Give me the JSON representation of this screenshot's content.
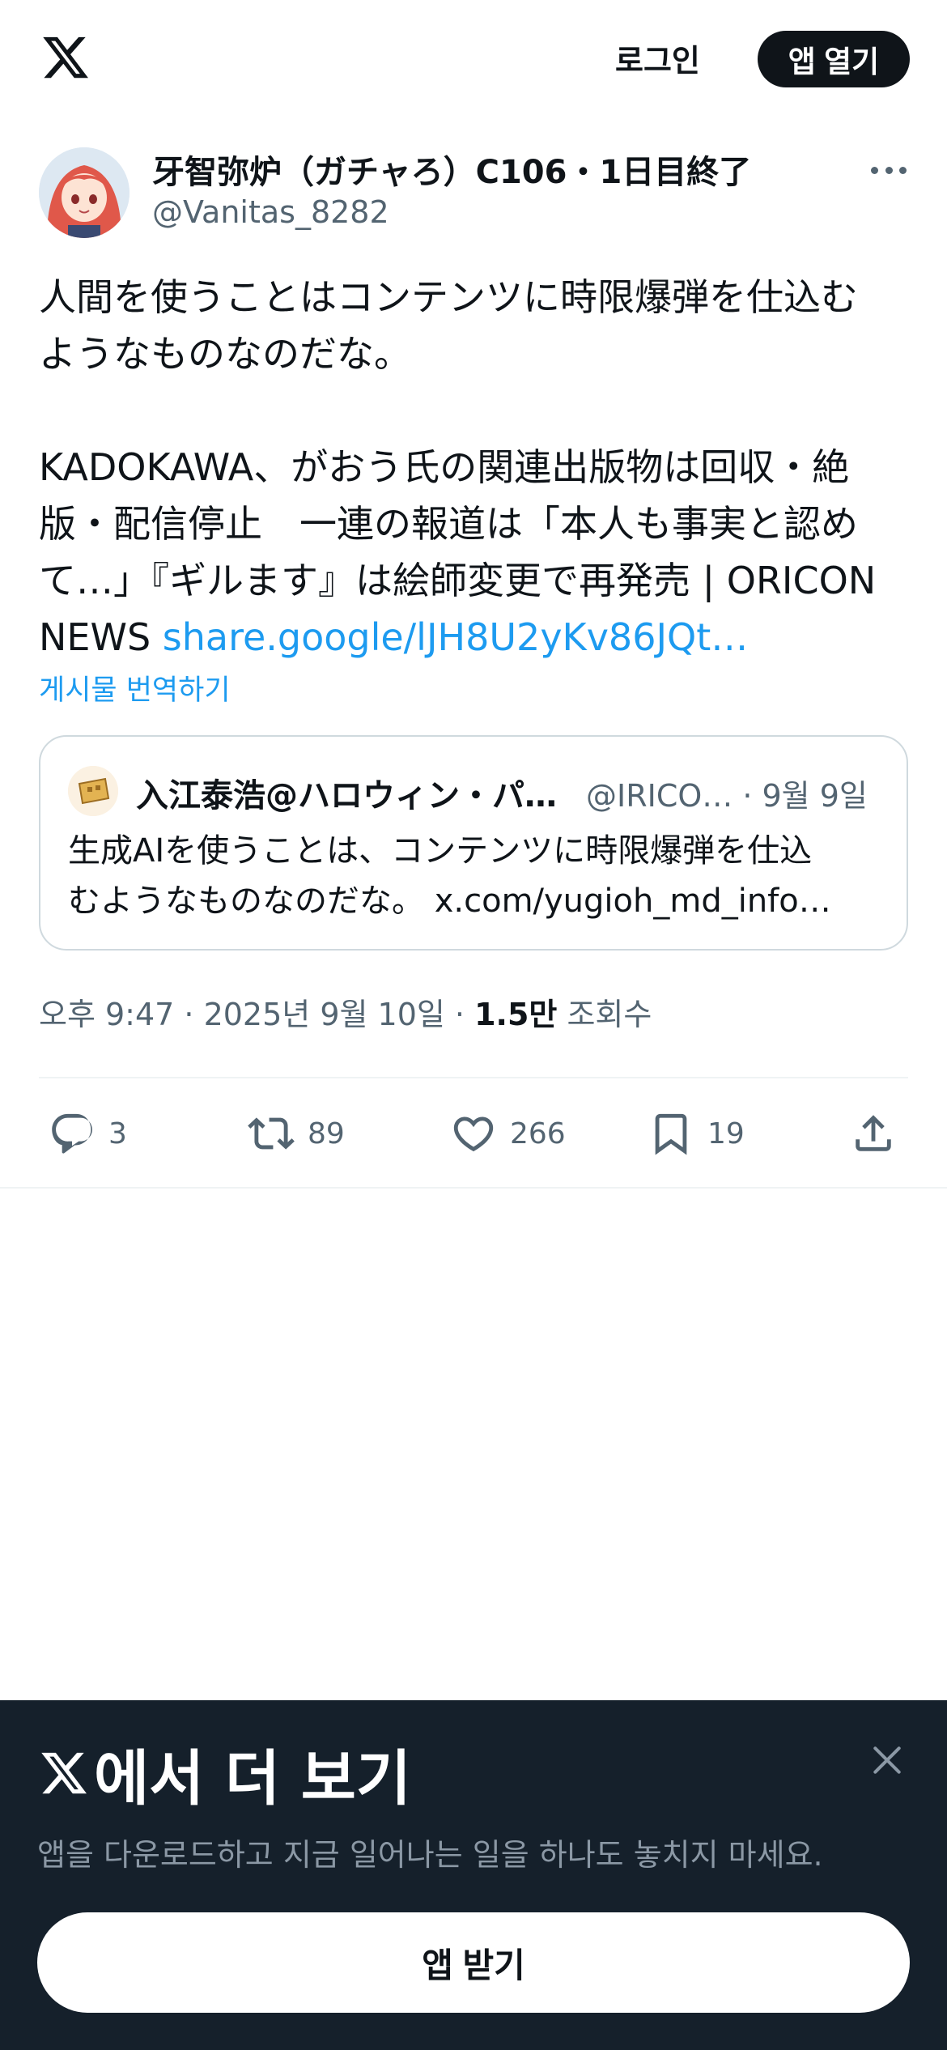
{
  "header": {
    "logo": "x-logo",
    "login_label": "로그인",
    "open_app_label": "앱 열기"
  },
  "tweet": {
    "author": {
      "name": "牙智弥炉（ガチャろ）C106・1日目終了",
      "handle": "@Vanitas_8282"
    },
    "text_lines": [
      "人間を使うことはコンテンツに時限爆弾を仕込む",
      "ようなものなのだな。",
      "",
      "KADOKAWA、がおう氏の関連出版物は回収・絶",
      "版・配信停止　一連の報道は「本人も事実と認め",
      "て…」『ギルます』は絵師変更で再発売 | ORICON"
    ],
    "last_line_prefix": "NEWS ",
    "link": "share.google/lJH8U2yKv86JQt…",
    "translate_label": "게시물 번역하기",
    "quote": {
      "name": "入江泰浩@ハロウィン・パ…",
      "handle_date": "@IRICO… · 9월 9일",
      "text_lines": [
        "生成AIを使うことは、コンテンツに時限爆弾を仕込",
        "むようなものなのだな。 x.com/yugioh_md_info…"
      ]
    },
    "timestamp": "오후 9:47 · 2025년 9월 10일 · ",
    "views_count": "1.5만",
    "views_label": " 조회수",
    "actions": {
      "reply": {
        "icon": "reply-icon",
        "count": "3"
      },
      "retweet": {
        "icon": "retweet-icon",
        "count": "89"
      },
      "like": {
        "icon": "heart-icon",
        "count": "266"
      },
      "bookmark": {
        "icon": "bookmark-icon",
        "count": "19"
      },
      "share": {
        "icon": "share-icon"
      }
    }
  },
  "bottom_sheet": {
    "title_suffix": "에서 더 보기",
    "subtitle": "앱을 다운로드하고 지금 일어나는 일을 하나도 놓치지 마세요.",
    "button_label": "앱 받기",
    "close_icon": "close-icon"
  },
  "colors": {
    "accent": "#1d9bf0",
    "text": "#0f1419",
    "secondary": "#536471",
    "sheet_bg": "#15202b"
  }
}
